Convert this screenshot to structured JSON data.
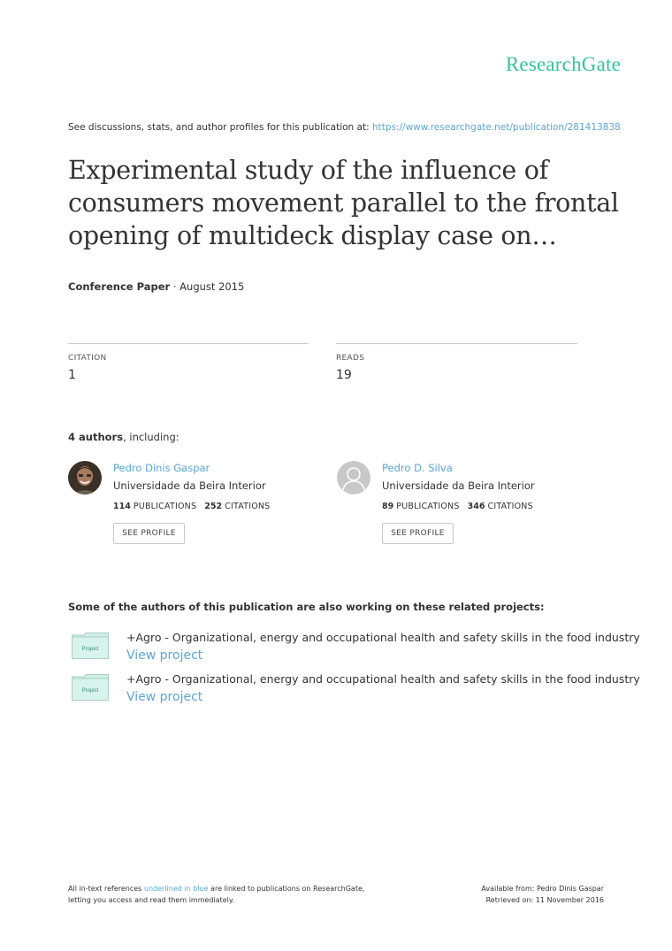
{
  "header": {
    "logo": "ResearchGate"
  },
  "discussion": {
    "prefix": "See discussions, stats, and author profiles for this publication at: ",
    "url": "https://www.researchgate.net/publication/281413838"
  },
  "publication": {
    "title": "Experimental study of the influence of consumers movement parallel to the frontal opening of multideck display case on…",
    "type": "Conference Paper",
    "separator": " · ",
    "date": "August 2015"
  },
  "stats": {
    "citation_label": "CITATION",
    "citation_value": "1",
    "reads_label": "READS",
    "reads_value": "19"
  },
  "authors_heading": {
    "count": "4 authors",
    "suffix": ", including:"
  },
  "authors": [
    {
      "name": "Pedro Dinis Gaspar",
      "institution": "Universidade da Beira Interior",
      "publications": "114",
      "publications_label": "PUBLICATIONS",
      "citations": "252",
      "citations_label": "CITATIONS",
      "button": "SEE PROFILE"
    },
    {
      "name": "Pedro D. Silva",
      "institution": "Universidade da Beira Interior",
      "publications": "89",
      "publications_label": "PUBLICATIONS",
      "citations": "346",
      "citations_label": "CITATIONS",
      "button": "SEE PROFILE"
    }
  ],
  "projects": {
    "heading": "Some of the authors of this publication are also working on these related projects:",
    "items": [
      {
        "icon_label": "Project",
        "title": "+Agro - Organizational, energy and occupational health and safety skills in the food industry",
        "link": "View project"
      },
      {
        "icon_label": "Project",
        "title": "+Agro - Organizational, energy and occupational health and safety skills in the food industry",
        "link": "View project"
      }
    ]
  },
  "footer": {
    "left_line1_prefix": "All in-text references ",
    "left_line1_link": "underlined in blue",
    "left_line1_suffix": " are linked to publications on ResearchGate,",
    "left_line2": "letting you access and read them immediately.",
    "right_line1": "Available from: Pedro Dinis Gaspar",
    "right_line2": "Retrieved on: 11 November 2016"
  },
  "colors": {
    "brand": "#34c3a1",
    "link": "#5aa6d8",
    "text": "#333333"
  },
  "icons": [
    "author-photo",
    "default-avatar-icon",
    "project-folder-icon"
  ]
}
